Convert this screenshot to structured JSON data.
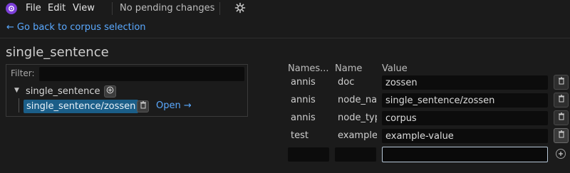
{
  "menubar": {
    "items": [
      "File",
      "Edit",
      "View"
    ],
    "status": "No pending changes"
  },
  "nav": {
    "back_label": "Go back to corpus selection"
  },
  "page_title": "single_sentence",
  "filter": {
    "label": "Filter:",
    "value": ""
  },
  "tree": {
    "root_label": "single_sentence",
    "child_label": "single_sentence/zossen",
    "open_label": "Open"
  },
  "table": {
    "headers": [
      "Names...",
      "Name",
      "Value"
    ],
    "rows": [
      {
        "namespace": "annis",
        "name": "doc",
        "value": "zossen"
      },
      {
        "namespace": "annis",
        "name": "node_na",
        "value": "single_sentence/zossen"
      },
      {
        "namespace": "annis",
        "name": "node_typ",
        "value": "corpus"
      },
      {
        "namespace": "test",
        "name": "example",
        "value": "example-value"
      }
    ],
    "new_row": {
      "namespace": "",
      "name": "",
      "value": ""
    }
  },
  "colors": {
    "accent": "#5aa9ff",
    "selection": "#1b5e88",
    "logo": "#7c3fd8"
  }
}
